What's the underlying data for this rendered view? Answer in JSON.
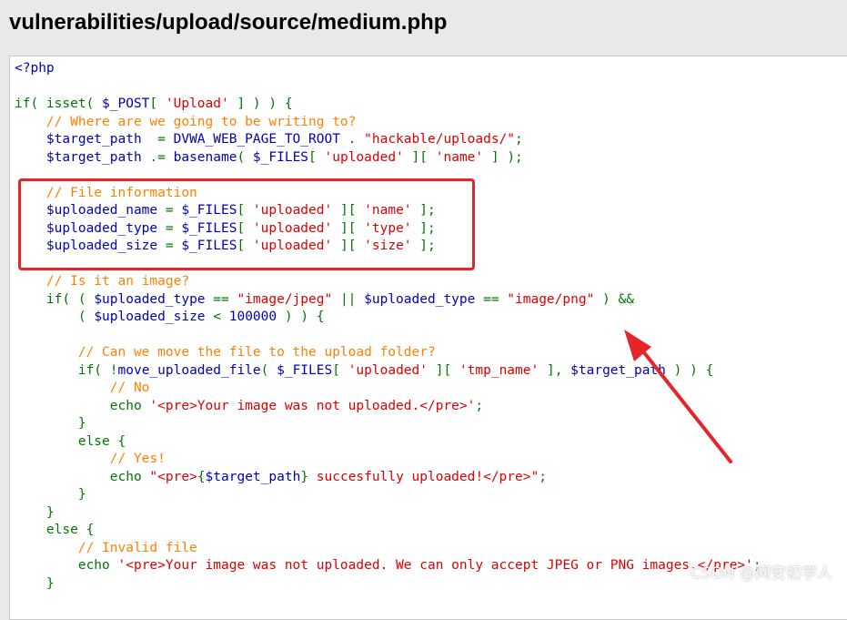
{
  "page": {
    "title": "vulnerabilities/upload/source/medium.php"
  },
  "code": {
    "lines": [
      {
        "segments": [
          {
            "t": "php",
            "v": "<?php"
          }
        ]
      },
      {
        "segments": []
      },
      {
        "segments": [
          {
            "t": "kw",
            "v": "if( isset( "
          },
          {
            "t": "var",
            "v": "$_POST"
          },
          {
            "t": "kw",
            "v": "[ "
          },
          {
            "t": "str",
            "v": "'Upload'"
          },
          {
            "t": "kw",
            "v": " ] ) ) {"
          }
        ]
      },
      {
        "segments": [
          {
            "t": "pl",
            "v": "    "
          },
          {
            "t": "cm",
            "v": "// Where are we going to be writing to?"
          }
        ]
      },
      {
        "segments": [
          {
            "t": "pl",
            "v": "    "
          },
          {
            "t": "var",
            "v": "$target_path"
          },
          {
            "t": "kw",
            "v": "  = "
          },
          {
            "t": "var",
            "v": "DVWA_WEB_PAGE_TO_ROOT"
          },
          {
            "t": "kw",
            "v": " . "
          },
          {
            "t": "str",
            "v": "\"hackable/uploads/\""
          },
          {
            "t": "kw",
            "v": ";"
          }
        ]
      },
      {
        "segments": [
          {
            "t": "pl",
            "v": "    "
          },
          {
            "t": "var",
            "v": "$target_path"
          },
          {
            "t": "kw",
            "v": " .= "
          },
          {
            "t": "var",
            "v": "basename"
          },
          {
            "t": "kw",
            "v": "( "
          },
          {
            "t": "var",
            "v": "$_FILES"
          },
          {
            "t": "kw",
            "v": "[ "
          },
          {
            "t": "str",
            "v": "'uploaded'"
          },
          {
            "t": "kw",
            "v": " ][ "
          },
          {
            "t": "str",
            "v": "'name'"
          },
          {
            "t": "kw",
            "v": " ] );"
          }
        ]
      },
      {
        "segments": []
      },
      {
        "segments": [
          {
            "t": "pl",
            "v": "    "
          },
          {
            "t": "cm",
            "v": "// File information"
          }
        ]
      },
      {
        "segments": [
          {
            "t": "pl",
            "v": "    "
          },
          {
            "t": "var",
            "v": "$uploaded_name"
          },
          {
            "t": "kw",
            "v": " = "
          },
          {
            "t": "var",
            "v": "$_FILES"
          },
          {
            "t": "kw",
            "v": "[ "
          },
          {
            "t": "str",
            "v": "'uploaded'"
          },
          {
            "t": "kw",
            "v": " ][ "
          },
          {
            "t": "str",
            "v": "'name'"
          },
          {
            "t": "kw",
            "v": " ];"
          }
        ]
      },
      {
        "segments": [
          {
            "t": "pl",
            "v": "    "
          },
          {
            "t": "var",
            "v": "$uploaded_type"
          },
          {
            "t": "kw",
            "v": " = "
          },
          {
            "t": "var",
            "v": "$_FILES"
          },
          {
            "t": "kw",
            "v": "[ "
          },
          {
            "t": "str",
            "v": "'uploaded'"
          },
          {
            "t": "kw",
            "v": " ][ "
          },
          {
            "t": "str",
            "v": "'type'"
          },
          {
            "t": "kw",
            "v": " ];"
          }
        ]
      },
      {
        "segments": [
          {
            "t": "pl",
            "v": "    "
          },
          {
            "t": "var",
            "v": "$uploaded_size"
          },
          {
            "t": "kw",
            "v": " = "
          },
          {
            "t": "var",
            "v": "$_FILES"
          },
          {
            "t": "kw",
            "v": "[ "
          },
          {
            "t": "str",
            "v": "'uploaded'"
          },
          {
            "t": "kw",
            "v": " ][ "
          },
          {
            "t": "str",
            "v": "'size'"
          },
          {
            "t": "kw",
            "v": " ];"
          }
        ]
      },
      {
        "segments": []
      },
      {
        "segments": [
          {
            "t": "pl",
            "v": "    "
          },
          {
            "t": "cm",
            "v": "// Is it an image?"
          }
        ]
      },
      {
        "segments": [
          {
            "t": "pl",
            "v": "    "
          },
          {
            "t": "kw",
            "v": "if( ( "
          },
          {
            "t": "var",
            "v": "$uploaded_type"
          },
          {
            "t": "kw",
            "v": " == "
          },
          {
            "t": "str",
            "v": "\"image/jpeg\""
          },
          {
            "t": "kw",
            "v": " || "
          },
          {
            "t": "var",
            "v": "$uploaded_type"
          },
          {
            "t": "kw",
            "v": " == "
          },
          {
            "t": "str",
            "v": "\"image/png\""
          },
          {
            "t": "kw",
            "v": " ) &&"
          }
        ]
      },
      {
        "segments": [
          {
            "t": "pl",
            "v": "        "
          },
          {
            "t": "kw",
            "v": "( "
          },
          {
            "t": "var",
            "v": "$uploaded_size"
          },
          {
            "t": "kw",
            "v": " < "
          },
          {
            "t": "var",
            "v": "100000"
          },
          {
            "t": "kw",
            "v": " ) ) {"
          }
        ]
      },
      {
        "segments": []
      },
      {
        "segments": [
          {
            "t": "pl",
            "v": "        "
          },
          {
            "t": "cm",
            "v": "// Can we move the file to the upload folder?"
          }
        ]
      },
      {
        "segments": [
          {
            "t": "pl",
            "v": "        "
          },
          {
            "t": "kw",
            "v": "if( !"
          },
          {
            "t": "var",
            "v": "move_uploaded_file"
          },
          {
            "t": "kw",
            "v": "( "
          },
          {
            "t": "var",
            "v": "$_FILES"
          },
          {
            "t": "kw",
            "v": "[ "
          },
          {
            "t": "str",
            "v": "'uploaded'"
          },
          {
            "t": "kw",
            "v": " ][ "
          },
          {
            "t": "str",
            "v": "'tmp_name'"
          },
          {
            "t": "kw",
            "v": " ], "
          },
          {
            "t": "var",
            "v": "$target_path"
          },
          {
            "t": "kw",
            "v": " ) ) {"
          }
        ]
      },
      {
        "segments": [
          {
            "t": "pl",
            "v": "            "
          },
          {
            "t": "cm",
            "v": "// No"
          }
        ]
      },
      {
        "segments": [
          {
            "t": "pl",
            "v": "            "
          },
          {
            "t": "kw",
            "v": "echo "
          },
          {
            "t": "str",
            "v": "'<pre>Your image was not uploaded.</pre>'"
          },
          {
            "t": "kw",
            "v": ";"
          }
        ]
      },
      {
        "segments": [
          {
            "t": "pl",
            "v": "        "
          },
          {
            "t": "kw",
            "v": "}"
          }
        ]
      },
      {
        "segments": [
          {
            "t": "pl",
            "v": "        "
          },
          {
            "t": "kw",
            "v": "else {"
          }
        ]
      },
      {
        "segments": [
          {
            "t": "pl",
            "v": "            "
          },
          {
            "t": "cm",
            "v": "// Yes!"
          }
        ]
      },
      {
        "segments": [
          {
            "t": "pl",
            "v": "            "
          },
          {
            "t": "kw",
            "v": "echo "
          },
          {
            "t": "str",
            "v": "\"<pre>"
          },
          {
            "t": "kw",
            "v": "{"
          },
          {
            "t": "var",
            "v": "$target_path"
          },
          {
            "t": "kw",
            "v": "}"
          },
          {
            "t": "str",
            "v": " succesfully uploaded!</pre>\""
          },
          {
            "t": "kw",
            "v": ";"
          }
        ]
      },
      {
        "segments": [
          {
            "t": "pl",
            "v": "        "
          },
          {
            "t": "kw",
            "v": "}"
          }
        ]
      },
      {
        "segments": [
          {
            "t": "pl",
            "v": "    "
          },
          {
            "t": "kw",
            "v": "}"
          }
        ]
      },
      {
        "segments": [
          {
            "t": "pl",
            "v": "    "
          },
          {
            "t": "kw",
            "v": "else {"
          }
        ]
      },
      {
        "segments": [
          {
            "t": "pl",
            "v": "        "
          },
          {
            "t": "cm",
            "v": "// Invalid file"
          }
        ]
      },
      {
        "segments": [
          {
            "t": "pl",
            "v": "        "
          },
          {
            "t": "kw",
            "v": "echo "
          },
          {
            "t": "str",
            "v": "'<pre>Your image was not uploaded. We can only accept JPEG or PNG images.</pre>'"
          },
          {
            "t": "kw",
            "v": ";"
          }
        ]
      },
      {
        "segments": [
          {
            "t": "pl",
            "v": "    "
          },
          {
            "t": "kw",
            "v": "}"
          }
        ]
      }
    ]
  },
  "annotation": {
    "highlight_color": "#e6252b",
    "watermark": "CSDN @网安初学人"
  },
  "colors": {
    "page_background": "#e9e9e9",
    "code_background": "#ffffff",
    "keyword": "#007700",
    "string": "#dd0000",
    "variable": "#0000bb",
    "comment": "#ff8000"
  }
}
